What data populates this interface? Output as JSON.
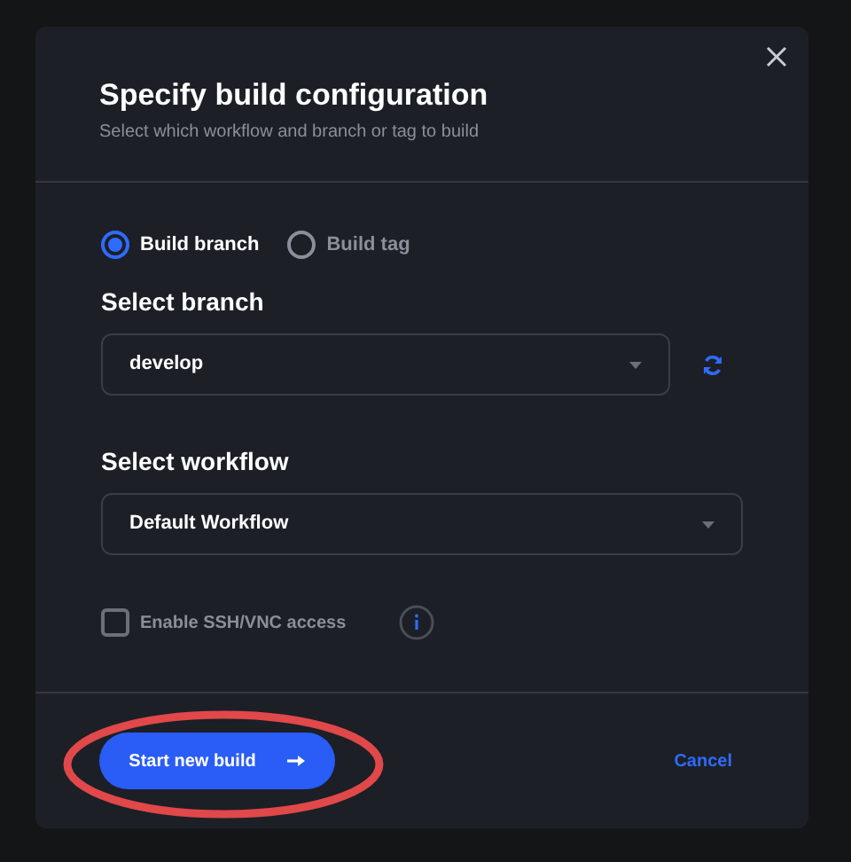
{
  "dialog": {
    "title": "Specify build configuration",
    "subtitle": "Select which workflow and branch or tag to build"
  },
  "build_options": [
    {
      "label": "Build branch",
      "selected": true
    },
    {
      "label": "Build tag",
      "selected": false
    }
  ],
  "branch": {
    "label": "Select branch",
    "value": "develop"
  },
  "workflow": {
    "label": "Select workflow",
    "value": "Default Workflow"
  },
  "ssh_access": {
    "label": "Enable SSH/VNC access",
    "checked": false
  },
  "start_button": {
    "label": "Start new build",
    "highlighted": true
  },
  "cancel_button": {
    "label": "Cancel"
  }
}
